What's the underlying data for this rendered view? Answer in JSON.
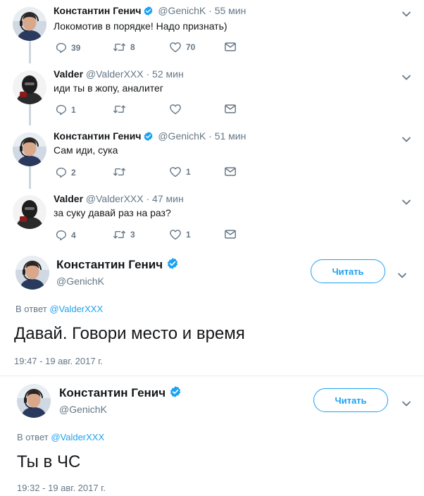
{
  "colors": {
    "accent": "#1da1f2",
    "muted": "#657786",
    "text": "#14171a",
    "thread_line": "#ccd6dd"
  },
  "thread": [
    {
      "name": "Константин Генич",
      "verified": true,
      "handle": "@GenichK",
      "separator": "·",
      "time": "55 мин",
      "text": "Локомотив в порядке! Надо признать)",
      "replies": "39",
      "retweets": "8",
      "likes": "70",
      "avatar_icon": "man-with-headset-avatar"
    },
    {
      "name": "Valder",
      "verified": false,
      "handle": "@ValderXXX",
      "separator": "·",
      "time": "52 мин",
      "text": "иди ты в жопу, аналитег",
      "replies": "1",
      "retweets": "",
      "likes": "",
      "avatar_icon": "hooded-figure-avatar"
    },
    {
      "name": "Константин Генич",
      "verified": true,
      "handle": "@GenichK",
      "separator": "·",
      "time": "51 мин",
      "text": "Сам иди, сука",
      "replies": "2",
      "retweets": "",
      "likes": "1",
      "avatar_icon": "man-with-headset-avatar"
    },
    {
      "name": "Valder",
      "verified": false,
      "handle": "@ValderXXX",
      "separator": "·",
      "time": "47 мин",
      "text": "за суку давай раз на раз?",
      "replies": "4",
      "retweets": "3",
      "likes": "1",
      "avatar_icon": "hooded-figure-avatar"
    }
  ],
  "expanded": [
    {
      "name": "Константин Генич",
      "handle": "@GenichK",
      "follow_label": "Читать",
      "reply_prefix": "В ответ",
      "reply_handle": "@ValderXXX",
      "text": "Давай. Говори место и время",
      "timestamp": "19:47 - 19 авг. 2017 г."
    },
    {
      "name": "Константин Генич",
      "handle": "@GenichK",
      "follow_label": "Читать",
      "reply_prefix": "В ответ",
      "reply_handle": "@ValderXXX",
      "text": "Ты в ЧС",
      "timestamp": "19:32 - 19 авг. 2017 г."
    }
  ]
}
